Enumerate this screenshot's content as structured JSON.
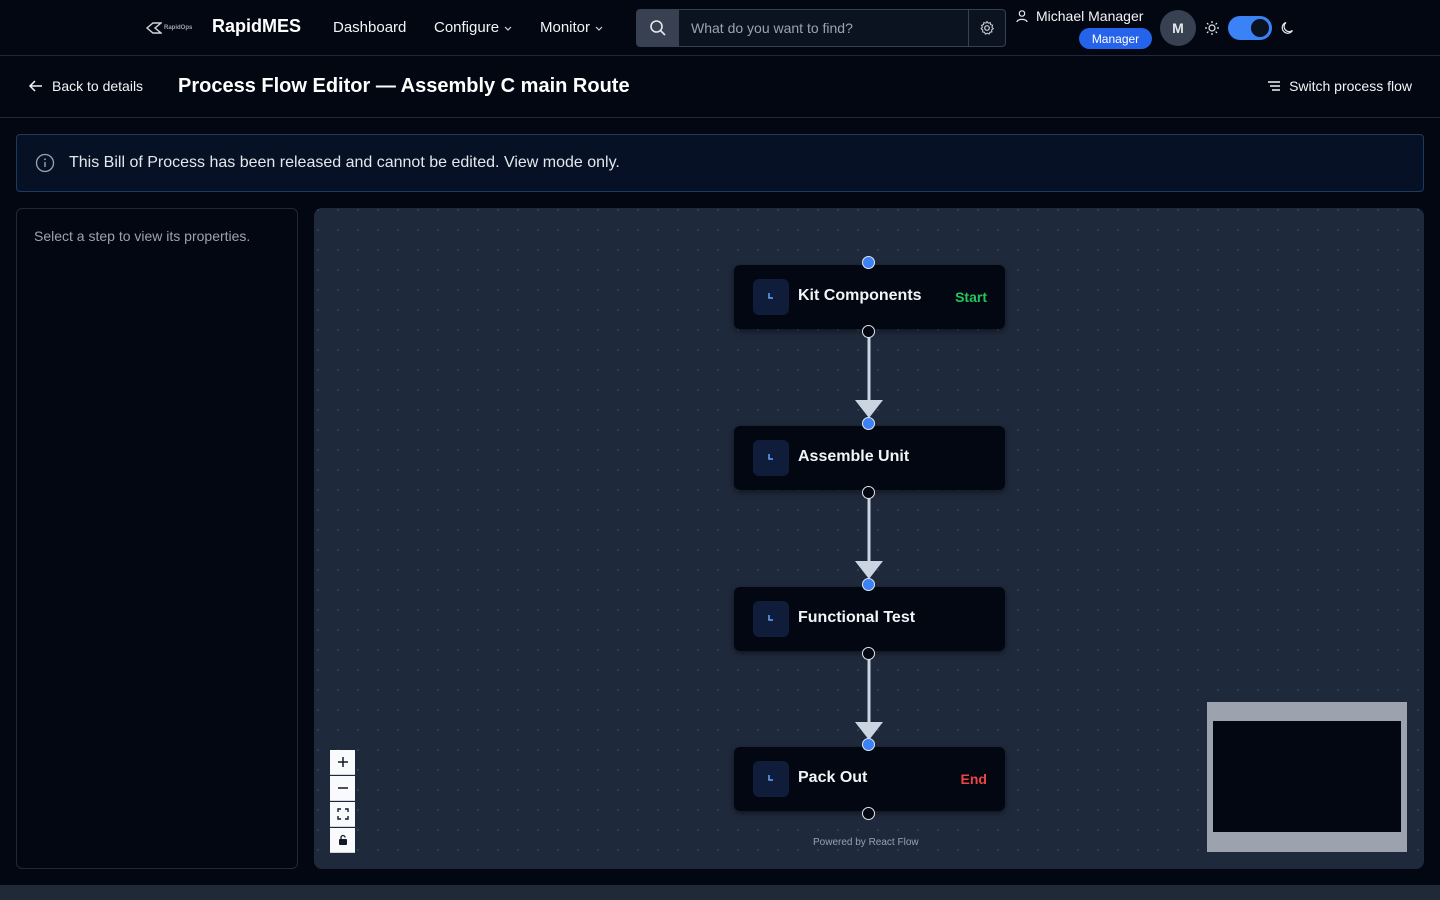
{
  "header": {
    "logo_small_text": "RapidOps",
    "brand": "RapidMES",
    "nav": [
      {
        "label": "Dashboard"
      },
      {
        "label": "Configure"
      },
      {
        "label": "Monitor"
      }
    ],
    "search": {
      "placeholder": "What do you want to find?",
      "value": ""
    },
    "user": {
      "name": "Michael Manager",
      "role": "Manager",
      "avatar_initial": "M"
    },
    "theme_toggle": {
      "state": "dark"
    }
  },
  "subheader": {
    "back_label": "Back to details",
    "title": "Process Flow Editor — Assembly C main Route",
    "switch_label": "Switch process flow"
  },
  "alert": {
    "message": "This Bill of Process has been released and cannot be edited. View mode only."
  },
  "properties": {
    "hint": "Select a step to view its properties."
  },
  "flow": {
    "nodes": [
      {
        "label": "Kit Components",
        "tag": "Start"
      },
      {
        "label": "Assemble Unit",
        "tag": ""
      },
      {
        "label": "Functional Test",
        "tag": ""
      },
      {
        "label": "Pack Out",
        "tag": "End"
      }
    ],
    "attribution": "Powered by React Flow"
  },
  "colors": {
    "accent": "#3b82f6",
    "start_tag": "#22c55e",
    "end_tag": "#ef4444",
    "canvas_bg": "#1e293b"
  }
}
